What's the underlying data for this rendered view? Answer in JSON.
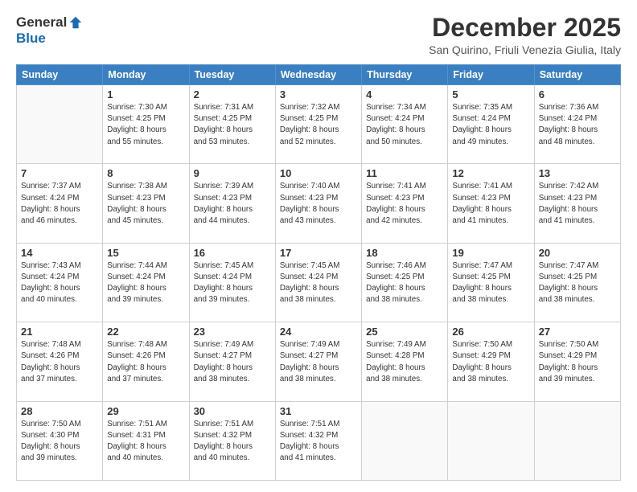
{
  "logo": {
    "general": "General",
    "blue": "Blue"
  },
  "header": {
    "month": "December 2025",
    "location": "San Quirino, Friuli Venezia Giulia, Italy"
  },
  "weekdays": [
    "Sunday",
    "Monday",
    "Tuesday",
    "Wednesday",
    "Thursday",
    "Friday",
    "Saturday"
  ],
  "weeks": [
    [
      {
        "day": "",
        "sunrise": "",
        "sunset": "",
        "daylight": ""
      },
      {
        "day": "1",
        "sunrise": "Sunrise: 7:30 AM",
        "sunset": "Sunset: 4:25 PM",
        "daylight": "Daylight: 8 hours and 55 minutes."
      },
      {
        "day": "2",
        "sunrise": "Sunrise: 7:31 AM",
        "sunset": "Sunset: 4:25 PM",
        "daylight": "Daylight: 8 hours and 53 minutes."
      },
      {
        "day": "3",
        "sunrise": "Sunrise: 7:32 AM",
        "sunset": "Sunset: 4:25 PM",
        "daylight": "Daylight: 8 hours and 52 minutes."
      },
      {
        "day": "4",
        "sunrise": "Sunrise: 7:34 AM",
        "sunset": "Sunset: 4:24 PM",
        "daylight": "Daylight: 8 hours and 50 minutes."
      },
      {
        "day": "5",
        "sunrise": "Sunrise: 7:35 AM",
        "sunset": "Sunset: 4:24 PM",
        "daylight": "Daylight: 8 hours and 49 minutes."
      },
      {
        "day": "6",
        "sunrise": "Sunrise: 7:36 AM",
        "sunset": "Sunset: 4:24 PM",
        "daylight": "Daylight: 8 hours and 48 minutes."
      }
    ],
    [
      {
        "day": "7",
        "sunrise": "Sunrise: 7:37 AM",
        "sunset": "Sunset: 4:24 PM",
        "daylight": "Daylight: 8 hours and 46 minutes."
      },
      {
        "day": "8",
        "sunrise": "Sunrise: 7:38 AM",
        "sunset": "Sunset: 4:23 PM",
        "daylight": "Daylight: 8 hours and 45 minutes."
      },
      {
        "day": "9",
        "sunrise": "Sunrise: 7:39 AM",
        "sunset": "Sunset: 4:23 PM",
        "daylight": "Daylight: 8 hours and 44 minutes."
      },
      {
        "day": "10",
        "sunrise": "Sunrise: 7:40 AM",
        "sunset": "Sunset: 4:23 PM",
        "daylight": "Daylight: 8 hours and 43 minutes."
      },
      {
        "day": "11",
        "sunrise": "Sunrise: 7:41 AM",
        "sunset": "Sunset: 4:23 PM",
        "daylight": "Daylight: 8 hours and 42 minutes."
      },
      {
        "day": "12",
        "sunrise": "Sunrise: 7:41 AM",
        "sunset": "Sunset: 4:23 PM",
        "daylight": "Daylight: 8 hours and 41 minutes."
      },
      {
        "day": "13",
        "sunrise": "Sunrise: 7:42 AM",
        "sunset": "Sunset: 4:23 PM",
        "daylight": "Daylight: 8 hours and 41 minutes."
      }
    ],
    [
      {
        "day": "14",
        "sunrise": "Sunrise: 7:43 AM",
        "sunset": "Sunset: 4:24 PM",
        "daylight": "Daylight: 8 hours and 40 minutes."
      },
      {
        "day": "15",
        "sunrise": "Sunrise: 7:44 AM",
        "sunset": "Sunset: 4:24 PM",
        "daylight": "Daylight: 8 hours and 39 minutes."
      },
      {
        "day": "16",
        "sunrise": "Sunrise: 7:45 AM",
        "sunset": "Sunset: 4:24 PM",
        "daylight": "Daylight: 8 hours and 39 minutes."
      },
      {
        "day": "17",
        "sunrise": "Sunrise: 7:45 AM",
        "sunset": "Sunset: 4:24 PM",
        "daylight": "Daylight: 8 hours and 38 minutes."
      },
      {
        "day": "18",
        "sunrise": "Sunrise: 7:46 AM",
        "sunset": "Sunset: 4:25 PM",
        "daylight": "Daylight: 8 hours and 38 minutes."
      },
      {
        "day": "19",
        "sunrise": "Sunrise: 7:47 AM",
        "sunset": "Sunset: 4:25 PM",
        "daylight": "Daylight: 8 hours and 38 minutes."
      },
      {
        "day": "20",
        "sunrise": "Sunrise: 7:47 AM",
        "sunset": "Sunset: 4:25 PM",
        "daylight": "Daylight: 8 hours and 38 minutes."
      }
    ],
    [
      {
        "day": "21",
        "sunrise": "Sunrise: 7:48 AM",
        "sunset": "Sunset: 4:26 PM",
        "daylight": "Daylight: 8 hours and 37 minutes."
      },
      {
        "day": "22",
        "sunrise": "Sunrise: 7:48 AM",
        "sunset": "Sunset: 4:26 PM",
        "daylight": "Daylight: 8 hours and 37 minutes."
      },
      {
        "day": "23",
        "sunrise": "Sunrise: 7:49 AM",
        "sunset": "Sunset: 4:27 PM",
        "daylight": "Daylight: 8 hours and 38 minutes."
      },
      {
        "day": "24",
        "sunrise": "Sunrise: 7:49 AM",
        "sunset": "Sunset: 4:27 PM",
        "daylight": "Daylight: 8 hours and 38 minutes."
      },
      {
        "day": "25",
        "sunrise": "Sunrise: 7:49 AM",
        "sunset": "Sunset: 4:28 PM",
        "daylight": "Daylight: 8 hours and 38 minutes."
      },
      {
        "day": "26",
        "sunrise": "Sunrise: 7:50 AM",
        "sunset": "Sunset: 4:29 PM",
        "daylight": "Daylight: 8 hours and 38 minutes."
      },
      {
        "day": "27",
        "sunrise": "Sunrise: 7:50 AM",
        "sunset": "Sunset: 4:29 PM",
        "daylight": "Daylight: 8 hours and 39 minutes."
      }
    ],
    [
      {
        "day": "28",
        "sunrise": "Sunrise: 7:50 AM",
        "sunset": "Sunset: 4:30 PM",
        "daylight": "Daylight: 8 hours and 39 minutes."
      },
      {
        "day": "29",
        "sunrise": "Sunrise: 7:51 AM",
        "sunset": "Sunset: 4:31 PM",
        "daylight": "Daylight: 8 hours and 40 minutes."
      },
      {
        "day": "30",
        "sunrise": "Sunrise: 7:51 AM",
        "sunset": "Sunset: 4:32 PM",
        "daylight": "Daylight: 8 hours and 40 minutes."
      },
      {
        "day": "31",
        "sunrise": "Sunrise: 7:51 AM",
        "sunset": "Sunset: 4:32 PM",
        "daylight": "Daylight: 8 hours and 41 minutes."
      },
      {
        "day": "",
        "sunrise": "",
        "sunset": "",
        "daylight": ""
      },
      {
        "day": "",
        "sunrise": "",
        "sunset": "",
        "daylight": ""
      },
      {
        "day": "",
        "sunrise": "",
        "sunset": "",
        "daylight": ""
      }
    ]
  ]
}
